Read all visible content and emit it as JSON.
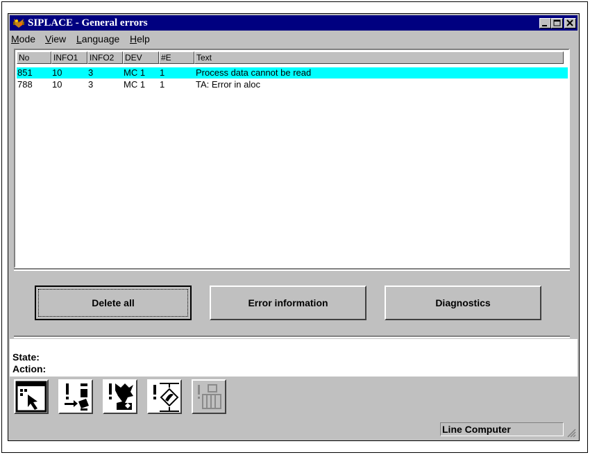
{
  "window": {
    "title": "SIPLACE - General errors",
    "controls": [
      "minimize",
      "maximize",
      "close"
    ]
  },
  "menu": [
    {
      "label": "Mode",
      "accel": "M"
    },
    {
      "label": "View",
      "accel": "V"
    },
    {
      "label": "Language",
      "accel": "L"
    },
    {
      "label": "Help",
      "accel": "H"
    }
  ],
  "list": {
    "columns": [
      "No",
      "INFO1",
      "INFO2",
      "DEV",
      "#E",
      "Text"
    ],
    "rows": [
      {
        "no": "851",
        "info1": "10",
        "info2": "3",
        "dev": "MC 1",
        "e": "1",
        "text": "Process data cannot be read",
        "selected": true
      },
      {
        "no": "788",
        "info1": "10",
        "info2": "3",
        "dev": "MC 1",
        "e": "1",
        "text": "TA: Error in aloc",
        "selected": false
      }
    ]
  },
  "buttons": {
    "delete_all": "Delete all",
    "error_information": "Error information",
    "diagnostics": "Diagnostics"
  },
  "state": {
    "state_label": "State:",
    "action_label": "Action:"
  },
  "toolbar": {
    "icons": [
      "select-pointer-icon",
      "error-transfer-icon",
      "error-machine-icon",
      "error-diagnostic-icon",
      "line-computer-icon"
    ]
  },
  "status": {
    "panel_text": "Line Computer"
  },
  "colors": {
    "titlebar": "#000080",
    "selection": "#00ffff",
    "face": "#c0c0c0"
  }
}
